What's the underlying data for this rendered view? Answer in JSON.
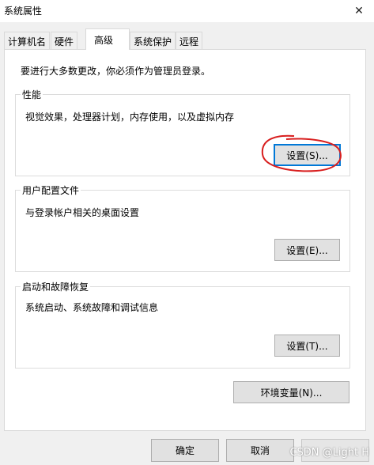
{
  "window": {
    "title": "系统属性",
    "close_icon": "close-icon"
  },
  "tabs": [
    {
      "label": "计算机名",
      "active": false
    },
    {
      "label": "硬件",
      "active": false
    },
    {
      "label": "高级",
      "active": true
    },
    {
      "label": "系统保护",
      "active": false
    },
    {
      "label": "远程",
      "active": false
    }
  ],
  "panel": {
    "intro": "要进行大多数更改，你必须作为管理员登录。",
    "groups": [
      {
        "title": "性能",
        "description": "视觉效果，处理器计划，内存使用，以及虚拟内存",
        "button": "设置(S)..."
      },
      {
        "title": "用户配置文件",
        "description": "与登录帐户相关的桌面设置",
        "button": "设置(E)..."
      },
      {
        "title": "启动和故障恢复",
        "description": "系统启动、系统故障和调试信息",
        "button": "设置(T)..."
      }
    ],
    "env_button": "环境变量(N)..."
  },
  "footer": {
    "ok": "确定",
    "cancel": "取消"
  },
  "watermark": "CSDN @Light H",
  "colors": {
    "focus_border": "#0078d7",
    "annotation_red": "#d81e1e"
  }
}
